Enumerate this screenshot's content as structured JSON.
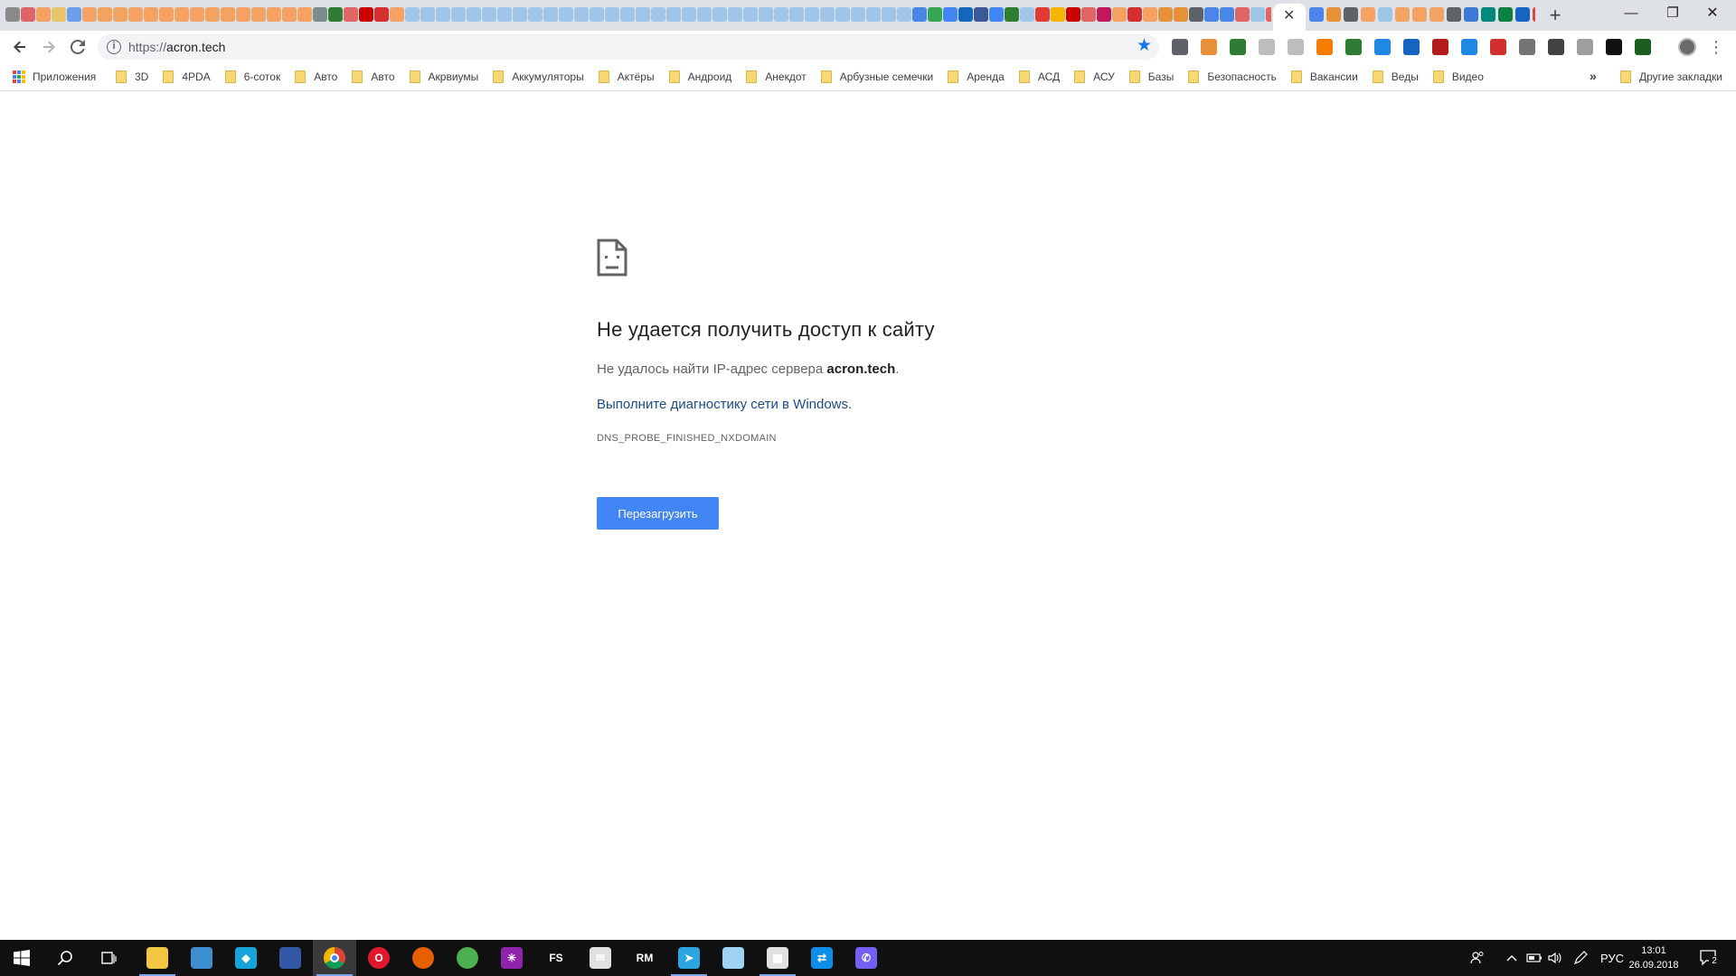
{
  "browser": {
    "tab_favicon_colors": [
      "#8a8a8a",
      "#e06666",
      "#f4a261",
      "#e9c46a",
      "#6d9eeb",
      "#f4a261",
      "#f4a261",
      "#f4a261",
      "#f4a261",
      "#f4a261",
      "#f4a261",
      "#f4a261",
      "#f4a261",
      "#f4a261",
      "#f4a261",
      "#f4a261",
      "#f4a261",
      "#f4a261",
      "#f4a261",
      "#f4a261",
      "#7f8c8d",
      "#2e7d32",
      "#e06666",
      "#cc0000",
      "#d32f2f",
      "#f4a261",
      "#9fc5e8",
      "#9fc5e8",
      "#9fc5e8",
      "#9fc5e8",
      "#9fc5e8",
      "#9fc5e8",
      "#9fc5e8",
      "#9fc5e8",
      "#9fc5e8",
      "#9fc5e8",
      "#9fc5e8",
      "#9fc5e8",
      "#9fc5e8",
      "#9fc5e8",
      "#9fc5e8",
      "#9fc5e8",
      "#9fc5e8",
      "#9fc5e8",
      "#9fc5e8",
      "#9fc5e8",
      "#9fc5e8",
      "#9fc5e8",
      "#9fc5e8",
      "#9fc5e8",
      "#9fc5e8",
      "#9fc5e8",
      "#9fc5e8",
      "#9fc5e8",
      "#9fc5e8",
      "#9fc5e8",
      "#9fc5e8",
      "#9fc5e8",
      "#9fc5e8",
      "#4a86e8",
      "#34a853",
      "#4285f4",
      "#1565c0",
      "#3b5998",
      "#4285f4",
      "#2e7d32",
      "#9fc5e8",
      "#e53935",
      "#f4b400",
      "#cc0000",
      "#e06666",
      "#c2185b",
      "#f4a261",
      "#d32f2f",
      "#f4a261",
      "#e69138",
      "#e69138",
      "#5f6368",
      "#4a86e8",
      "#4a86e8",
      "#e06666",
      "#9fc5e8",
      "#e06666",
      "#f4a261",
      "#d32f2f",
      "#f4a261",
      "#d32f2f",
      "#e06666",
      "#9fc5e8",
      "#f4a261",
      "#9fc5e8",
      "#00897b",
      "#9fc5e8",
      "#5f6368",
      "#9fc5e8",
      "#c62828",
      "#e06666",
      "#5f6368",
      "#5f6368"
    ],
    "tab_favicon_colors_right": [
      "#4a86e8",
      "#e69138",
      "#5f6368",
      "#f4a261",
      "#9fc5e8",
      "#f4a261",
      "#f4a261",
      "#f4a261",
      "#5f6368",
      "#3c78d8",
      "#00897b",
      "#0b8043",
      "#1565c0",
      "#ea4335",
      "#4285f4",
      "#f4b400"
    ],
    "active_tab_close": "✕",
    "new_tab_icon": "+",
    "window_controls": {
      "minimize": "—",
      "maximize": "❐",
      "close": "✕"
    },
    "url_scheme": "https://",
    "url_host": "acron.tech",
    "bookmark_star_icon": "★",
    "extension_colors": [
      "#5f6368",
      "#e69138",
      "#2e7d32",
      "#bdbdbd",
      "#bdbdbd",
      "#f57c00",
      "#2e7d32",
      "#1e88e5",
      "#1565c0",
      "#b71c1c",
      "#1e88e5",
      "#d32f2f",
      "#757575",
      "#424242",
      "#9e9e9e",
      "#111111",
      "#1b5e20"
    ],
    "menu_icon": "⋮"
  },
  "bookmarks": {
    "apps_label": "Приложения",
    "items": [
      "3D",
      "4PDA",
      "6-соток",
      "Авто",
      "Авто",
      "Акрвиумы",
      "Аккумуляторы",
      "Актёры",
      "Андроид",
      "Анекдот",
      "Арбузные семечки",
      "Аренда",
      "АСД",
      "АСУ",
      "Базы",
      "Безопасность",
      "Вакансии",
      "Веды",
      "Видео"
    ],
    "more_icon": "»",
    "other_label": "Другие закладки"
  },
  "error": {
    "title": "Не удается получить доступ к сайту",
    "desc_prefix": "Не удалось найти IP-адрес сервера ",
    "desc_host": "acron.tech",
    "desc_suffix": ".",
    "link": "Выполните диагностику сети в Windows",
    "link_suffix": ".",
    "code": "DNS_PROBE_FINISHED_NXDOMAIN",
    "reload_label": "Перезагрузить"
  },
  "taskbar": {
    "apps": [
      {
        "name": "file-explorer",
        "color": "#f4c542",
        "glyph": ""
      },
      {
        "name": "settings-panel",
        "color": "#3d8fd1",
        "glyph": ""
      },
      {
        "name": "kodi",
        "color": "#17a2d8",
        "glyph": "◆"
      },
      {
        "name": "save-disk",
        "color": "#3157a5",
        "glyph": ""
      },
      {
        "name": "chrome",
        "color": "#e2a72e",
        "glyph": ""
      },
      {
        "name": "opera",
        "color": "#e0182d",
        "glyph": "O"
      },
      {
        "name": "firefox",
        "color": "#e66000",
        "glyph": ""
      },
      {
        "name": "globe",
        "color": "#4caf50",
        "glyph": ""
      },
      {
        "name": "pinwheel",
        "color": "#8e24aa",
        "glyph": "✳"
      },
      {
        "name": "fs",
        "color": "#101010",
        "glyph": "FS"
      },
      {
        "name": "mail",
        "color": "#e0e0e0",
        "glyph": "✉"
      },
      {
        "name": "rm",
        "color": "#101010",
        "glyph": "RM"
      },
      {
        "name": "telegram",
        "color": "#2ca5e0",
        "glyph": "➤"
      },
      {
        "name": "notepad",
        "color": "#9fd3f5",
        "glyph": ""
      },
      {
        "name": "calculator",
        "color": "#e0e0e0",
        "glyph": "▦"
      },
      {
        "name": "teamviewer",
        "color": "#0e8ee9",
        "glyph": "⇄"
      },
      {
        "name": "viber",
        "color": "#7360f2",
        "glyph": "✆"
      }
    ],
    "language": "РУС",
    "time": "13:01",
    "date": "26.09.2018",
    "notification_count": "2"
  }
}
